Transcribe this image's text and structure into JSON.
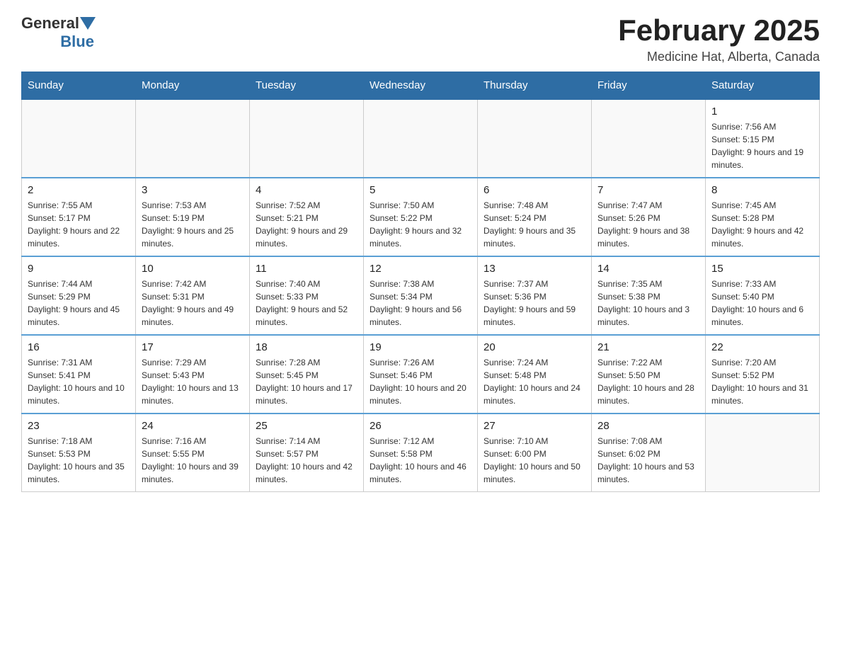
{
  "logo": {
    "general": "General",
    "blue": "Blue"
  },
  "title": "February 2025",
  "location": "Medicine Hat, Alberta, Canada",
  "days_of_week": [
    "Sunday",
    "Monday",
    "Tuesday",
    "Wednesday",
    "Thursday",
    "Friday",
    "Saturday"
  ],
  "weeks": [
    [
      {
        "day": "",
        "info": ""
      },
      {
        "day": "",
        "info": ""
      },
      {
        "day": "",
        "info": ""
      },
      {
        "day": "",
        "info": ""
      },
      {
        "day": "",
        "info": ""
      },
      {
        "day": "",
        "info": ""
      },
      {
        "day": "1",
        "info": "Sunrise: 7:56 AM\nSunset: 5:15 PM\nDaylight: 9 hours and 19 minutes."
      }
    ],
    [
      {
        "day": "2",
        "info": "Sunrise: 7:55 AM\nSunset: 5:17 PM\nDaylight: 9 hours and 22 minutes."
      },
      {
        "day": "3",
        "info": "Sunrise: 7:53 AM\nSunset: 5:19 PM\nDaylight: 9 hours and 25 minutes."
      },
      {
        "day": "4",
        "info": "Sunrise: 7:52 AM\nSunset: 5:21 PM\nDaylight: 9 hours and 29 minutes."
      },
      {
        "day": "5",
        "info": "Sunrise: 7:50 AM\nSunset: 5:22 PM\nDaylight: 9 hours and 32 minutes."
      },
      {
        "day": "6",
        "info": "Sunrise: 7:48 AM\nSunset: 5:24 PM\nDaylight: 9 hours and 35 minutes."
      },
      {
        "day": "7",
        "info": "Sunrise: 7:47 AM\nSunset: 5:26 PM\nDaylight: 9 hours and 38 minutes."
      },
      {
        "day": "8",
        "info": "Sunrise: 7:45 AM\nSunset: 5:28 PM\nDaylight: 9 hours and 42 minutes."
      }
    ],
    [
      {
        "day": "9",
        "info": "Sunrise: 7:44 AM\nSunset: 5:29 PM\nDaylight: 9 hours and 45 minutes."
      },
      {
        "day": "10",
        "info": "Sunrise: 7:42 AM\nSunset: 5:31 PM\nDaylight: 9 hours and 49 minutes."
      },
      {
        "day": "11",
        "info": "Sunrise: 7:40 AM\nSunset: 5:33 PM\nDaylight: 9 hours and 52 minutes."
      },
      {
        "day": "12",
        "info": "Sunrise: 7:38 AM\nSunset: 5:34 PM\nDaylight: 9 hours and 56 minutes."
      },
      {
        "day": "13",
        "info": "Sunrise: 7:37 AM\nSunset: 5:36 PM\nDaylight: 9 hours and 59 minutes."
      },
      {
        "day": "14",
        "info": "Sunrise: 7:35 AM\nSunset: 5:38 PM\nDaylight: 10 hours and 3 minutes."
      },
      {
        "day": "15",
        "info": "Sunrise: 7:33 AM\nSunset: 5:40 PM\nDaylight: 10 hours and 6 minutes."
      }
    ],
    [
      {
        "day": "16",
        "info": "Sunrise: 7:31 AM\nSunset: 5:41 PM\nDaylight: 10 hours and 10 minutes."
      },
      {
        "day": "17",
        "info": "Sunrise: 7:29 AM\nSunset: 5:43 PM\nDaylight: 10 hours and 13 minutes."
      },
      {
        "day": "18",
        "info": "Sunrise: 7:28 AM\nSunset: 5:45 PM\nDaylight: 10 hours and 17 minutes."
      },
      {
        "day": "19",
        "info": "Sunrise: 7:26 AM\nSunset: 5:46 PM\nDaylight: 10 hours and 20 minutes."
      },
      {
        "day": "20",
        "info": "Sunrise: 7:24 AM\nSunset: 5:48 PM\nDaylight: 10 hours and 24 minutes."
      },
      {
        "day": "21",
        "info": "Sunrise: 7:22 AM\nSunset: 5:50 PM\nDaylight: 10 hours and 28 minutes."
      },
      {
        "day": "22",
        "info": "Sunrise: 7:20 AM\nSunset: 5:52 PM\nDaylight: 10 hours and 31 minutes."
      }
    ],
    [
      {
        "day": "23",
        "info": "Sunrise: 7:18 AM\nSunset: 5:53 PM\nDaylight: 10 hours and 35 minutes."
      },
      {
        "day": "24",
        "info": "Sunrise: 7:16 AM\nSunset: 5:55 PM\nDaylight: 10 hours and 39 minutes."
      },
      {
        "day": "25",
        "info": "Sunrise: 7:14 AM\nSunset: 5:57 PM\nDaylight: 10 hours and 42 minutes."
      },
      {
        "day": "26",
        "info": "Sunrise: 7:12 AM\nSunset: 5:58 PM\nDaylight: 10 hours and 46 minutes."
      },
      {
        "day": "27",
        "info": "Sunrise: 7:10 AM\nSunset: 6:00 PM\nDaylight: 10 hours and 50 minutes."
      },
      {
        "day": "28",
        "info": "Sunrise: 7:08 AM\nSunset: 6:02 PM\nDaylight: 10 hours and 53 minutes."
      },
      {
        "day": "",
        "info": ""
      }
    ]
  ]
}
